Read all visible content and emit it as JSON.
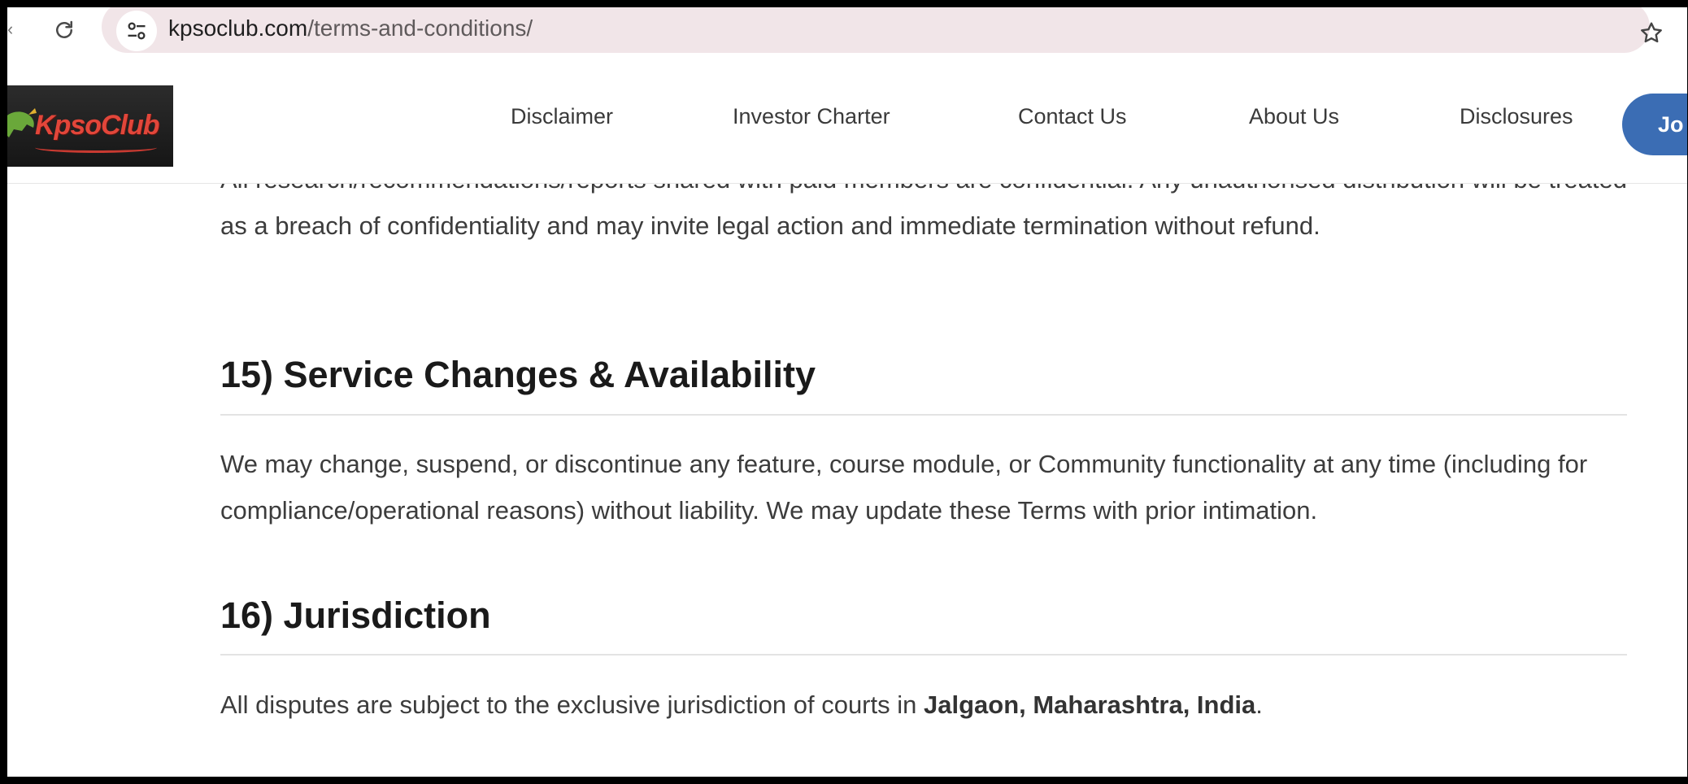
{
  "browser": {
    "url_host": "kpsoclub.com",
    "url_path": "/terms-and-conditions/",
    "icons": [
      "back-icon",
      "reload-icon",
      "site-settings-icon",
      "bookmark-star-icon"
    ]
  },
  "header": {
    "logo_text": "KpsoClub",
    "nav": [
      "Disclaimer",
      "Investor Charter",
      "Contact Us",
      "About Us",
      "Disclosures"
    ],
    "join_button": "Jo",
    "accent_color": "#3b6db4"
  },
  "content": {
    "intro_paragraph": "All research/recommendations/reports shared with paid members are confidential. Any unauthorised distribution will be treated as a breach of confidentiality and may invite legal action and immediate termination without refund.",
    "sections": [
      {
        "title": "15) Service Changes & Availability",
        "body": "We may change, suspend, or discontinue any feature, course module, or Community functionality at any time (including for compliance/operational reasons) without liability. We may update these Terms with prior intimation."
      },
      {
        "title": "16) Jurisdiction",
        "body_before": "All disputes are subject to the exclusive jurisdiction of courts in ",
        "body_strong": "Jalgaon, Maharashtra, India",
        "body_after": "."
      }
    ]
  }
}
